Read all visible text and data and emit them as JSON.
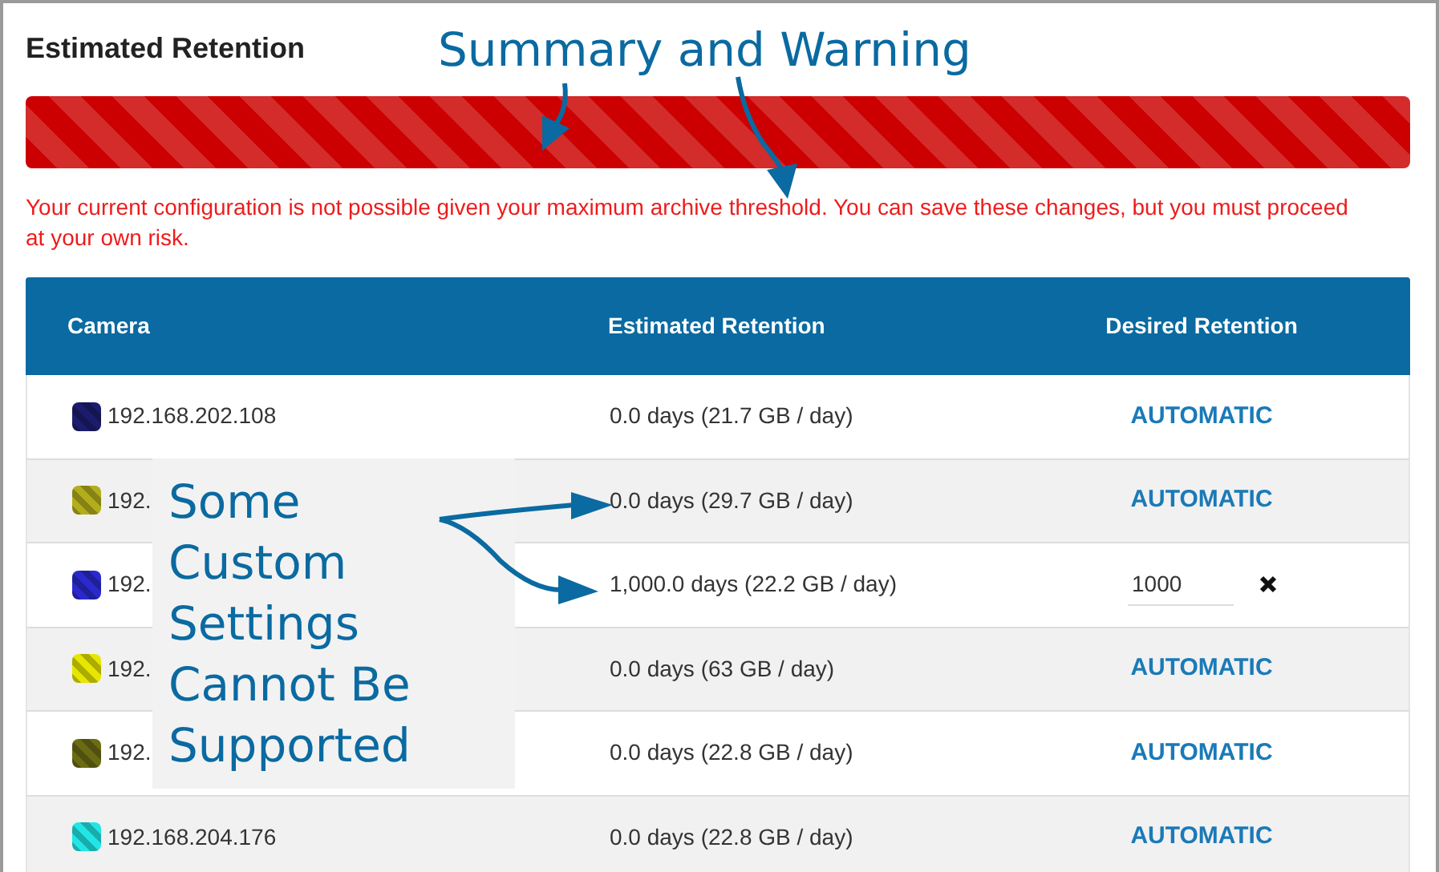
{
  "panel": {
    "title": "Estimated Retention"
  },
  "warning": {
    "text": "Your current configuration is not possible given your maximum archive threshold. You can save these changes, but you must proceed at your own risk."
  },
  "table": {
    "columns": [
      "Camera",
      "Estimated Retention",
      "Desired Retention"
    ],
    "rows": [
      {
        "camera": "192.168.202.108",
        "color": "#1c1c6e",
        "estimate": "0.0 days (21.7 GB / day)",
        "desired": {
          "kind": "automatic",
          "text": "AUTOMATIC"
        }
      },
      {
        "camera": "192.",
        "color": "#b3ad1c",
        "estimate": "0.0 days (29.7 GB / day)",
        "desired": {
          "kind": "automatic",
          "text": "AUTOMATIC"
        }
      },
      {
        "camera": "192.",
        "color": "#2a2acc",
        "estimate": "1,000.0 days (22.2 GB / day)",
        "desired": {
          "kind": "custom",
          "value": "1000"
        }
      },
      {
        "camera": "192.",
        "color": "#e6e600",
        "estimate": "0.0 days (63 GB / day)",
        "desired": {
          "kind": "automatic",
          "text": "AUTOMATIC"
        }
      },
      {
        "camera": "192.",
        "color": "#6b6b14",
        "estimate": "0.0 days (22.8 GB / day)",
        "desired": {
          "kind": "automatic",
          "text": "AUTOMATIC"
        }
      },
      {
        "camera": "192.168.204.176",
        "color": "#22e6e6",
        "estimate": "0.0 days (22.8 GB / day)",
        "desired": {
          "kind": "automatic",
          "text": "AUTOMATIC"
        }
      }
    ]
  },
  "callouts": [
    {
      "text": "Summary and Warning"
    },
    {
      "text": "Some Custom Settings Cannot Be Supported"
    }
  ]
}
